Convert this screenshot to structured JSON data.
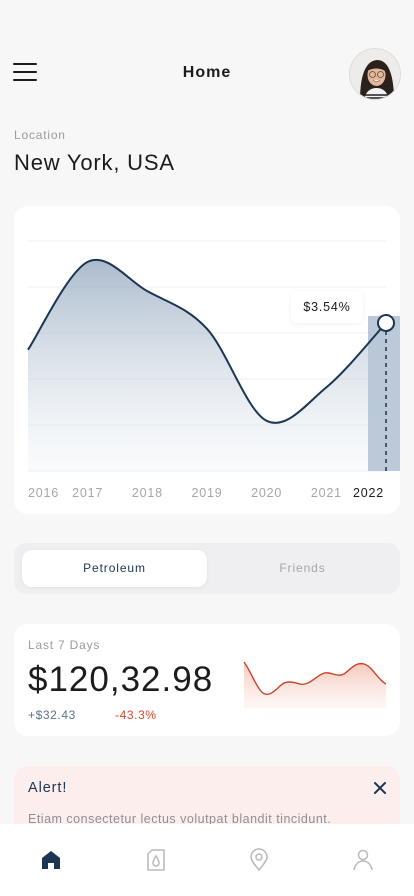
{
  "header": {
    "title": "Home",
    "menu_icon": "hamburger-menu-icon",
    "avatar_icon": "user-avatar"
  },
  "location": {
    "label": "Location",
    "value": "New York, USA"
  },
  "chart_data": {
    "type": "area",
    "x": [
      "2016",
      "2017",
      "2018",
      "2019",
      "2020",
      "2021",
      "2022"
    ],
    "tick_labels": [
      "2016",
      "2017",
      "2018",
      "2019",
      "2020",
      "2021",
      "2022"
    ],
    "active_tick": "2022",
    "series": [
      {
        "values": [
          2.9,
          5.0,
          4.3,
          3.4,
          1.2,
          2.0,
          3.54
        ]
      }
    ],
    "ylim": [
      0,
      5.5
    ],
    "grid": true,
    "annotation": {
      "x": "2022",
      "label": "$3.54%"
    },
    "colors": {
      "line": "#1c3552",
      "fill": "#8fa4bb",
      "highlight": "#b7c6d6"
    }
  },
  "tabs": {
    "active": "Petroleum",
    "inactive": "Friends"
  },
  "stats": {
    "label": "Last 7 Days",
    "value": "$120,32.98",
    "change": "+$32.43",
    "percent": "-43.3%",
    "spark_color": "#d4472a"
  },
  "alert": {
    "title": "Alert!",
    "body": "Etiam consectetur lectus volutpat blandit tincidunt.",
    "close_icon": "close-icon"
  },
  "nav": {
    "items": [
      "home-icon",
      "fuel-drop-icon",
      "location-pin-icon",
      "profile-icon"
    ],
    "active": "home-icon",
    "accent": "#1c3552"
  }
}
